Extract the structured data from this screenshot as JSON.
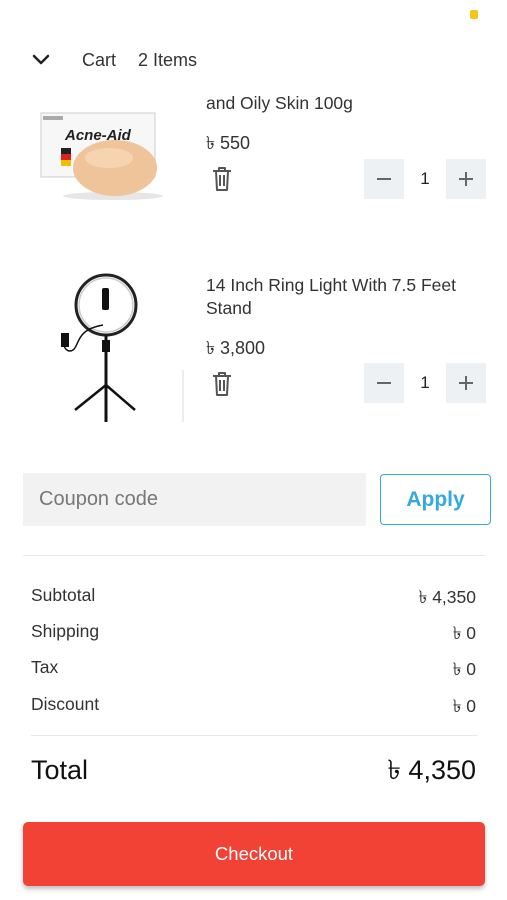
{
  "header": {
    "cart_label": "Cart",
    "items_count": "2 Items"
  },
  "items": [
    {
      "title": "and Oily Skin 100g",
      "price": "৳ 550",
      "quantity": "1",
      "image_text": "Acne-Aid"
    },
    {
      "title": "14 Inch Ring Light With 7.5 Feet Stand",
      "price": "৳ 3,800",
      "quantity": "1"
    }
  ],
  "coupon": {
    "placeholder": "Coupon code",
    "apply_label": "Apply"
  },
  "summary": {
    "subtotal_label": "Subtotal",
    "subtotal_value": "৳ 4,350",
    "shipping_label": "Shipping",
    "shipping_value": "৳ 0",
    "tax_label": "Tax",
    "tax_value": "৳ 0",
    "discount_label": "Discount",
    "discount_value": "৳ 0",
    "total_label": "Total",
    "total_value": "৳ 4,350"
  },
  "checkout_label": "Checkout",
  "colors": {
    "accent": "#34a9e0",
    "checkout": "#f24236",
    "stepper_bg": "#eef1f3",
    "input_bg": "#f2f2f2"
  },
  "icons": [
    "chevron-down-icon",
    "trash-icon",
    "minus-icon",
    "plus-icon"
  ]
}
